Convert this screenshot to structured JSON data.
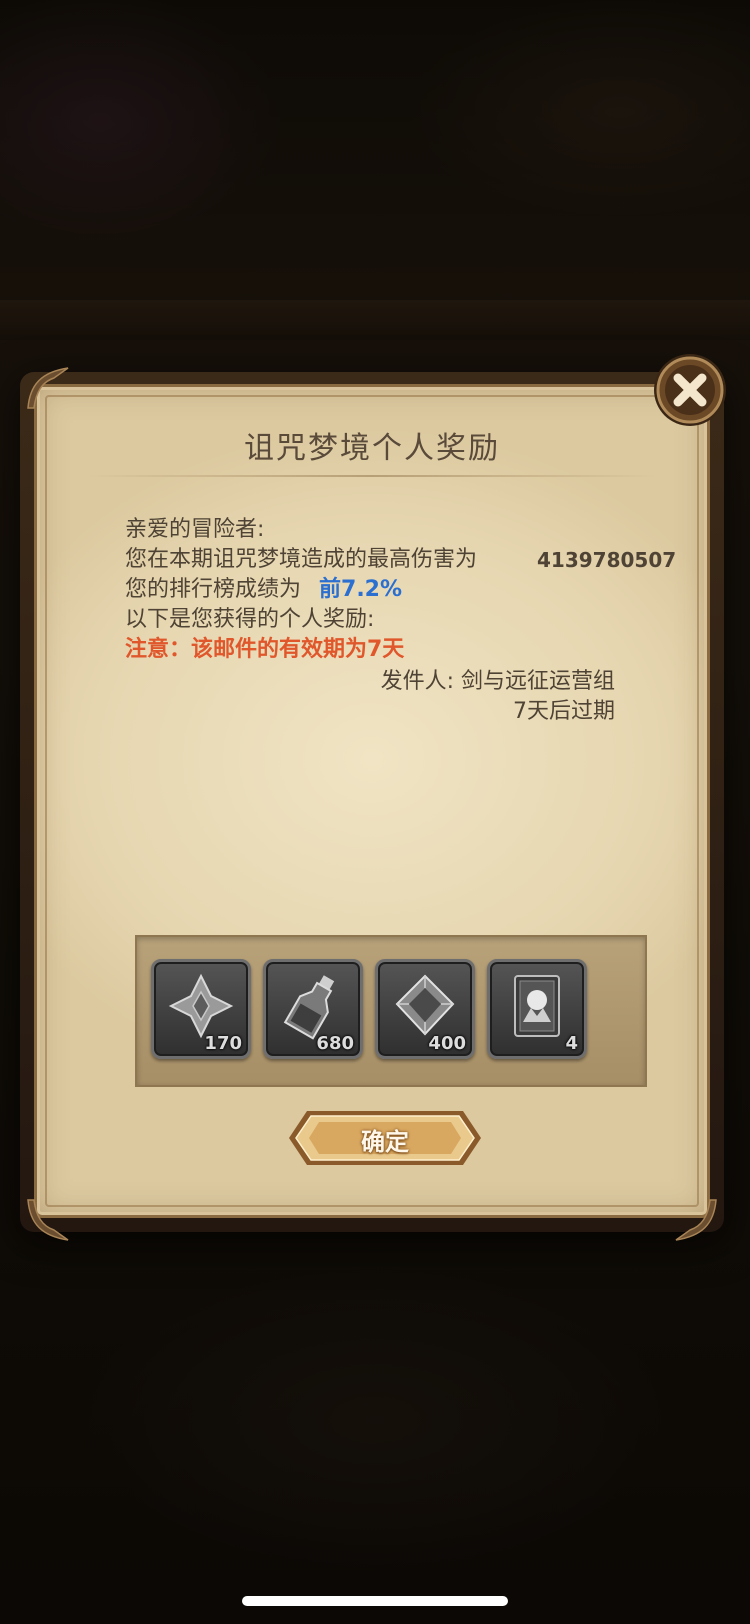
{
  "dialog": {
    "title": "诅咒梦境个人奖励",
    "greeting": "亲爱的冒险者:",
    "damage_text": "您在本期诅咒梦境造成的最高伤害为",
    "damage_value": "4139780507",
    "rank_text": "您的排行榜成绩为",
    "rank_value": "前7.2%",
    "rewards_text": "以下是您获得的个人奖励:",
    "notice": "注意：该邮件的有效期为7天",
    "sender": "发件人: 剑与远征运营组",
    "expiry": "7天后过期"
  },
  "rewards": [
    {
      "icon": "shuriken-shard-icon",
      "qty": "170"
    },
    {
      "icon": "potion-bottle-icon",
      "qty": "680"
    },
    {
      "icon": "diamond-crystal-icon",
      "qty": "400"
    },
    {
      "icon": "summon-card-icon",
      "qty": "4"
    }
  ],
  "buttons": {
    "confirm": "确定",
    "close_icon": "close-icon"
  },
  "colors": {
    "rank": "#2b6fd0",
    "notice": "#e0572c",
    "parchment": "#e6d6b0",
    "text": "#4e4334"
  }
}
